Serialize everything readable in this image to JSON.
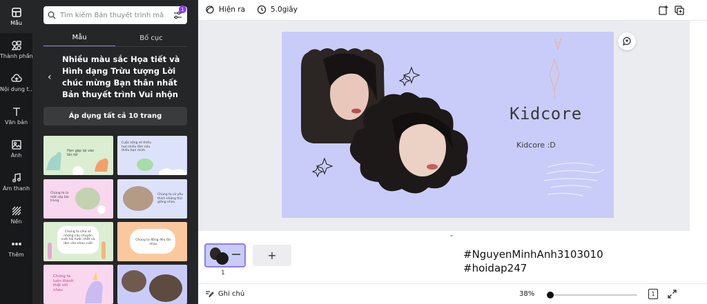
{
  "rail": {
    "items": [
      {
        "label": "Mẫu",
        "icon": "template-icon"
      },
      {
        "label": "Thành phần",
        "icon": "shapes-icon"
      },
      {
        "label": "Nội dung t...",
        "icon": "upload-cloud-icon"
      },
      {
        "label": "Văn bản",
        "icon": "text-icon"
      },
      {
        "label": "Ảnh",
        "icon": "image-icon"
      },
      {
        "label": "Âm thanh",
        "icon": "music-icon"
      },
      {
        "label": "Nền",
        "icon": "background-icon"
      },
      {
        "label": "Thêm",
        "icon": "more-dots-icon"
      }
    ]
  },
  "panel": {
    "search_placeholder": "Tìm kiếm Bản thuyết trình mẫu",
    "filter_badge": "1",
    "tabs": [
      "Mẫu",
      "Bố cục"
    ],
    "collection_title": "Nhiều màu sắc Họa tiết và Hình dạng Trừu tượng Lời chúc mừng Bạn thân nhất Bản thuyết trình Vui nhộn",
    "apply_label": "Áp dụng tất cả 10 trang",
    "thumbs": [
      {
        "text": "Hẹn gặp lại vào lần tới",
        "bg": "#dbeed2"
      },
      {
        "text": "Cuộc sống sẽ thiếu hụt nhiều lắm nếu thiếu bạn mình",
        "bg": "#dde2fb"
      },
      {
        "text": "Chúng ta là một cặp bài trùng",
        "bg": "#f9d7ee"
      },
      {
        "text": "Chúng ta cứ yêu thích những thứ giống nhau",
        "bg": "#dde2fb"
      },
      {
        "text": "Chúng ta chia sẻ những câu chuyện cười hài hước nhất và làm cho nhau cười",
        "bg": "#dbeed2"
      },
      {
        "text": "Chúng ta đồng đều lẫn nhau",
        "bg": "#fbc89e"
      },
      {
        "text": "Chúng ta luôn thành thật với nhau",
        "bg": "#f9d7ee"
      },
      {
        "text": "",
        "bg": "#c9ccf9"
      }
    ]
  },
  "toolbar": {
    "animate_label": "Hiện ra",
    "duration_label": "5.0giây"
  },
  "slide": {
    "title": "Kidcore",
    "subtitle": "Kidcore :D",
    "bg": "#c9ccf9"
  },
  "filmstrip": {
    "page_number": "1",
    "add_page_label": "+"
  },
  "hashtags": [
    "#NguyenMinhAnh3103010",
    "#hoidap247"
  ],
  "status": {
    "notes_label": "Ghi chú",
    "zoom": "38%",
    "page_count": "1"
  },
  "colors": {
    "accent": "#8b3dff",
    "rail_bg": "#18191b",
    "panel_bg": "#252627",
    "canvas_bg": "#ebecf0"
  }
}
